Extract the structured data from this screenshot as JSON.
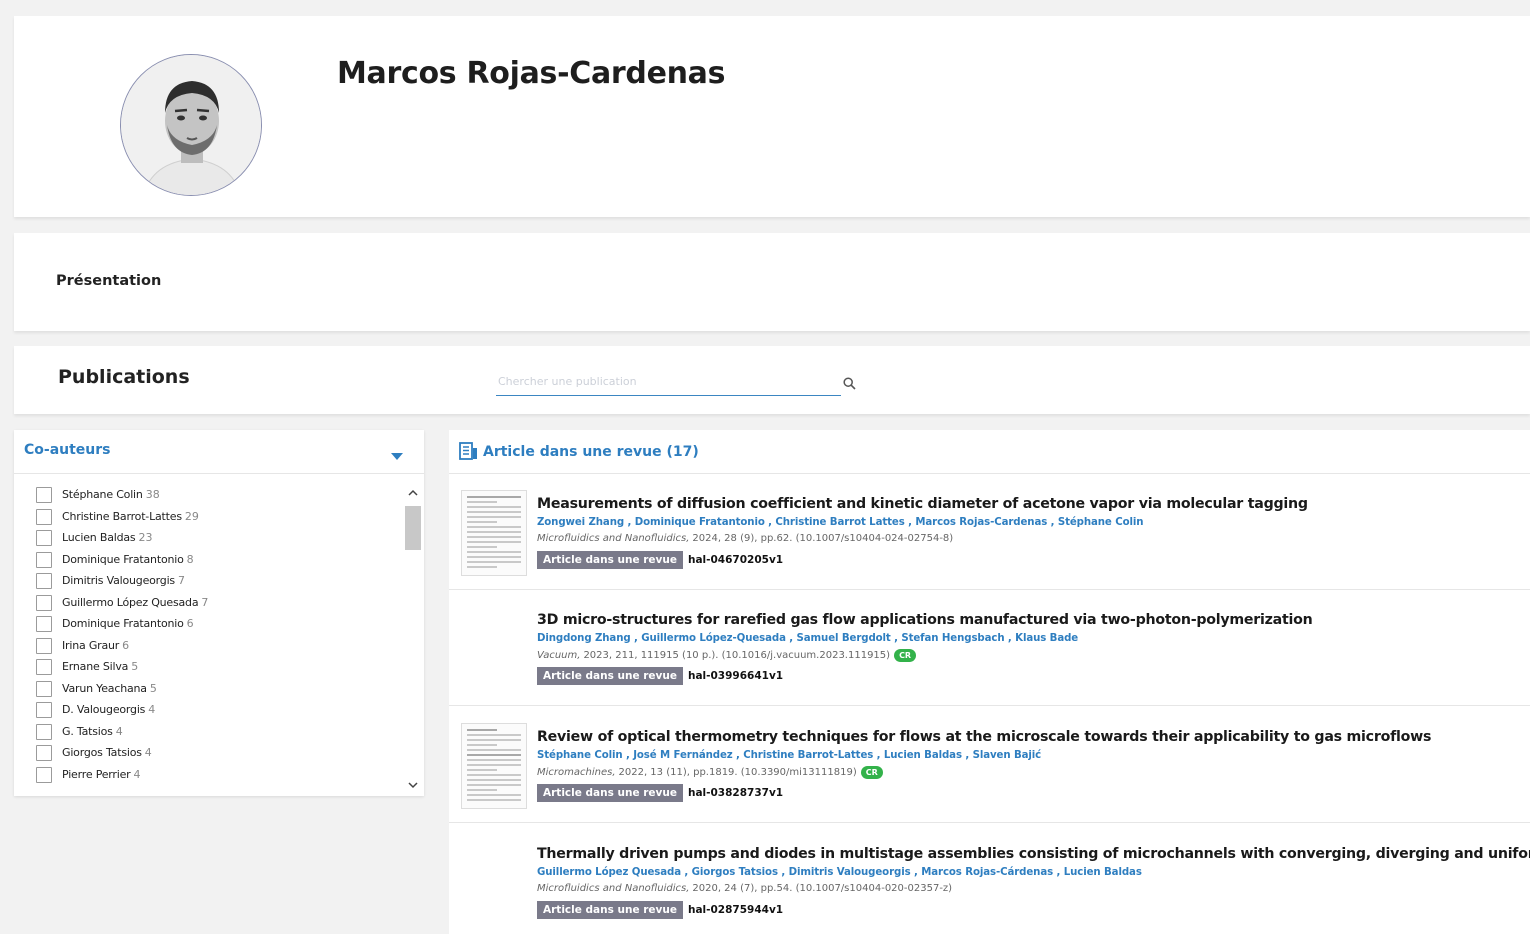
{
  "profile": {
    "name": "Marcos Rojas-Cardenas"
  },
  "presentation": {
    "title": "Présentation"
  },
  "publications": {
    "title": "Publications",
    "search_placeholder": "Chercher une publication"
  },
  "coauthors": {
    "title": "Co-auteurs",
    "items": [
      {
        "name": "Stéphane Colin",
        "count": "38"
      },
      {
        "name": "Christine Barrot-Lattes",
        "count": "29"
      },
      {
        "name": "Lucien Baldas",
        "count": "23"
      },
      {
        "name": "Dominique Fratantonio",
        "count": "8"
      },
      {
        "name": "Dimitris Valougeorgis",
        "count": "7"
      },
      {
        "name": "Guillermo López Quesada",
        "count": "7"
      },
      {
        "name": "Dominique Fratantonio",
        "count": "6"
      },
      {
        "name": "Irina Graur",
        "count": "6"
      },
      {
        "name": "Ernane Silva",
        "count": "5"
      },
      {
        "name": "Varun Yeachana",
        "count": "5"
      },
      {
        "name": "D. Valougeorgis",
        "count": "4"
      },
      {
        "name": "G. Tatsios",
        "count": "4"
      },
      {
        "name": "Giorgos Tatsios",
        "count": "4"
      },
      {
        "name": "Pierre Perrier",
        "count": "4"
      }
    ]
  },
  "articles_section": {
    "title": "Article dans une revue (17)",
    "items": [
      {
        "title": "Measurements of diffusion coefficient and kinetic diameter of acetone vapor via molecular tagging",
        "authors": "Zongwei Zhang , Dominique Fratantonio , Christine Barrot Lattes , Marcos Rojas-Cardenas , Stéphane Colin",
        "journal": "Microfluidics and Nanofluidics,",
        "details": "2024, 28 (9), pp.62. (10.1007/s10404-024-02754-8)",
        "cr": "",
        "type": "Article dans une revue",
        "hal_id": "hal-04670205v1"
      },
      {
        "title": "3D micro-structures for rarefied gas flow applications manufactured via two-photon-polymerization",
        "authors": "Dingdong Zhang , Guillermo López-Quesada , Samuel Bergdolt , Stefan Hengsbach , Klaus Bade",
        "journal": "Vacuum,",
        "details": "2023, 211, 111915 (10 p.). (10.1016/j.vacuum.2023.111915)",
        "cr": "CR",
        "type": "Article dans une revue",
        "hal_id": "hal-03996641v1"
      },
      {
        "title": "Review of optical thermometry techniques for flows at the microscale towards their applicability to gas microflows",
        "authors": "Stéphane Colin , José M Fernández , Christine Barrot-Lattes , Lucien Baldas , Slaven Bajić",
        "journal": "Micromachines,",
        "details": "2022, 13 (11), pp.1819. (10.3390/mi13111819)",
        "cr": "CR",
        "type": "Article dans une revue",
        "hal_id": "hal-03828737v1"
      },
      {
        "title": "Thermally driven pumps and diodes in multistage assemblies consisting of microchannels with converging, diverging and uniform rectan",
        "authors": "Guillermo López Quesada , Giorgos Tatsios , Dimitris Valougeorgis , Marcos Rojas-Cárdenas , Lucien Baldas",
        "journal": "Microfluidics and Nanofluidics,",
        "details": "2020, 24 (7), pp.54. (10.1007/s10404-020-02357-z)",
        "cr": "",
        "type": "Article dans une revue",
        "hal_id": "hal-02875944v1"
      }
    ]
  }
}
